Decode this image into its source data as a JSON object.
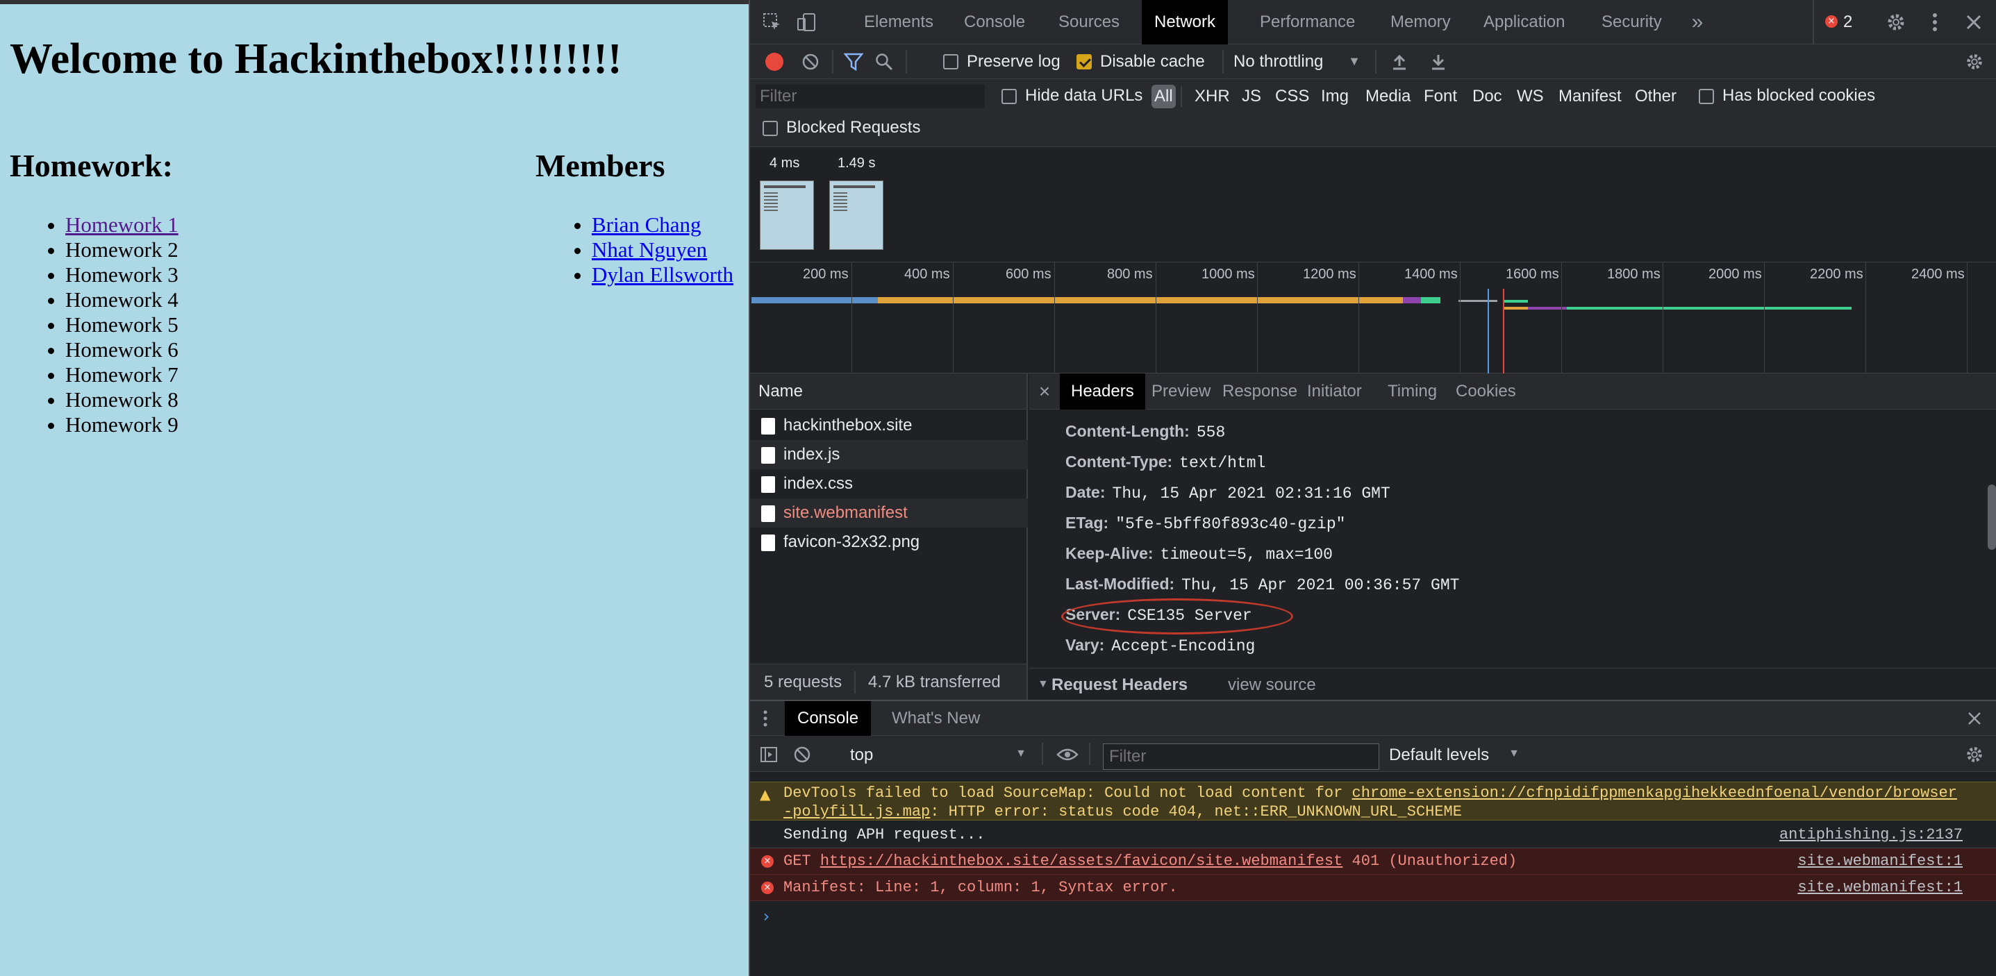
{
  "page": {
    "title": "Welcome to Hackinthebox!!!!!!!!!",
    "homework_heading": "Homework:",
    "members_heading": "Members",
    "homework": [
      "Homework 1",
      "Homework 2",
      "Homework 3",
      "Homework 4",
      "Homework 5",
      "Homework 6",
      "Homework 7",
      "Homework 8",
      "Homework 9"
    ],
    "members": [
      "Brian Chang",
      "Nhat Nguyen",
      "Dylan Ellsworth"
    ]
  },
  "devtools": {
    "tabs": [
      "Elements",
      "Console",
      "Sources",
      "Network",
      "Performance",
      "Memory",
      "Application",
      "Security"
    ],
    "active_tab": "Network",
    "more_tabs_icon": "»",
    "error_count": "2",
    "toolbar": {
      "preserve_log": "Preserve log",
      "disable_cache": "Disable cache",
      "throttling": "No throttling"
    },
    "filter": {
      "placeholder": "Filter",
      "hide_data_urls": "Hide data URLs",
      "types": [
        "All",
        "XHR",
        "JS",
        "CSS",
        "Img",
        "Media",
        "Font",
        "Doc",
        "WS",
        "Manifest",
        "Other"
      ],
      "has_blocked_cookies": "Has blocked cookies",
      "blocked_requests": "Blocked Requests"
    },
    "filmstrip": {
      "times": [
        "4 ms",
        "1.49 s"
      ]
    },
    "overview_ticks": [
      "200 ms",
      "400 ms",
      "600 ms",
      "800 ms",
      "1000 ms",
      "1200 ms",
      "1400 ms",
      "1600 ms",
      "1800 ms",
      "2000 ms",
      "2200 ms",
      "2400 ms"
    ],
    "requests": {
      "header": "Name",
      "items": [
        "hackinthebox.site",
        "index.js",
        "index.css",
        "site.webmanifest",
        "favicon-32x32.png"
      ],
      "summary_count": "5 requests",
      "summary_size": "4.7 kB transferred"
    },
    "detail": {
      "close": "×",
      "tabs": [
        "Headers",
        "Preview",
        "Response",
        "Initiator",
        "Timing",
        "Cookies"
      ],
      "headers": [
        {
          "k": "Content-Length:",
          "v": "558"
        },
        {
          "k": "Content-Type:",
          "v": "text/html"
        },
        {
          "k": "Date:",
          "v": "Thu, 15 Apr 2021 02:31:16 GMT"
        },
        {
          "k": "ETag:",
          "v": "\"5fe-5bff80f893c40-gzip\""
        },
        {
          "k": "Keep-Alive:",
          "v": "timeout=5, max=100"
        },
        {
          "k": "Last-Modified:",
          "v": "Thu, 15 Apr 2021 00:36:57 GMT"
        },
        {
          "k": "Server:",
          "v": "CSE135 Server"
        },
        {
          "k": "Vary:",
          "v": "Accept-Encoding"
        }
      ],
      "request_headers": "Request Headers",
      "view_source": "view source"
    },
    "drawer": {
      "tabs": [
        "Console",
        "What's New"
      ],
      "context": "top",
      "filter_placeholder": "Filter",
      "levels": "Default levels",
      "messages": {
        "warn_line1_prefix": "DevTools failed to load SourceMap: Could not load content for ",
        "warn_line1_link": "chrome-extension://cfnpidifppmenkapgihekkeednfoenal/vendor/browser",
        "warn_line2_link": "-polyfill.js.map",
        "warn_line2_suffix": ": HTTP error: status code 404, net::ERR_UNKNOWN_URL_SCHEME",
        "info": "Sending APH request...",
        "info_src": "antiphishing.js:2137",
        "err1_prefix": "GET ",
        "err1_link": "https://hackinthebox.site/assets/favicon/site.webmanifest",
        "err1_suffix": " 401 (Unauthorized)",
        "err1_src": "site.webmanifest:1",
        "err2": "Manifest: Line: 1, column: 1, Syntax error.",
        "err2_src": "site.webmanifest:1"
      }
    },
    "colors": {
      "accent_red": "#c0392b",
      "recording": "#e8473b",
      "warn_bg": "#413a1c",
      "err_bg": "#3c1a1a"
    }
  }
}
